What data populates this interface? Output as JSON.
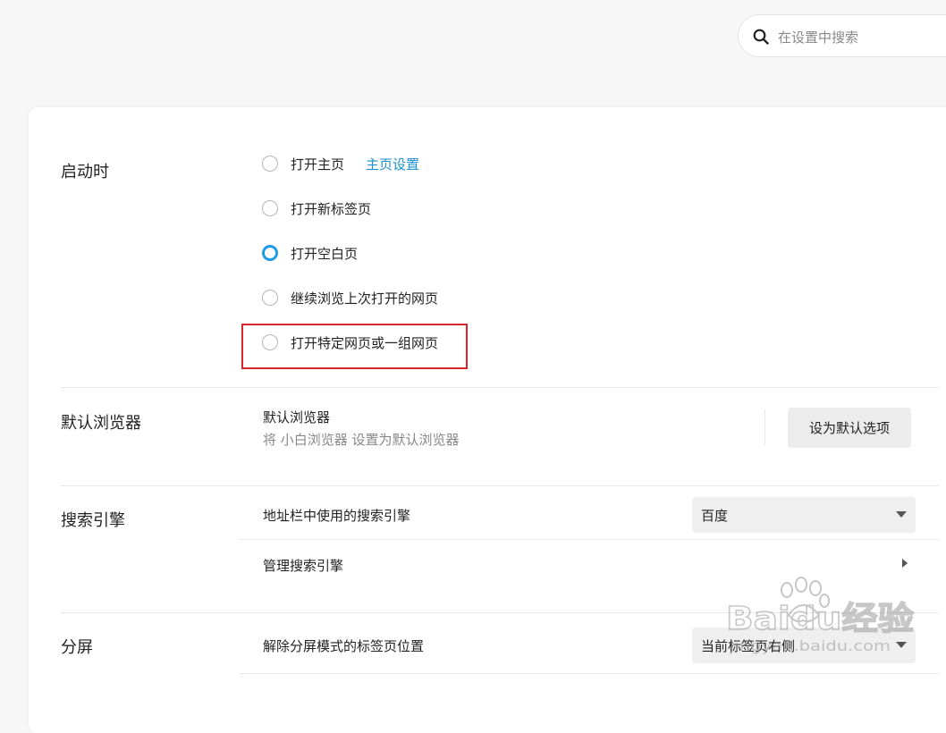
{
  "search": {
    "placeholder": "在设置中搜索"
  },
  "startup": {
    "title": "启动时",
    "options": [
      {
        "label": "打开主页",
        "checked": false
      },
      {
        "label": "打开新标签页",
        "checked": false
      },
      {
        "label": "打开空白页",
        "checked": true
      },
      {
        "label": "继续浏览上次打开的网页",
        "checked": false
      },
      {
        "label": "打开特定网页或一组网页",
        "checked": false
      }
    ],
    "homepage_link": "主页设置"
  },
  "default_browser": {
    "title": "默认浏览器",
    "heading": "默认浏览器",
    "description": "将 小白浏览器 设置为默认浏览器",
    "button": "设为默认选项"
  },
  "search_engine": {
    "title": "搜索引擎",
    "address_bar_label": "地址栏中使用的搜索引擎",
    "selected": "百度",
    "manage_label": "管理搜索引擎"
  },
  "split_screen": {
    "title": "分屏",
    "label": "解除分屏模式的标签页位置",
    "selected": "当前标签页右侧"
  },
  "watermark": {
    "brand": "Baidu经验",
    "url": "jingyan.baidu.com"
  },
  "colors": {
    "accent": "#1e9be9",
    "link": "#1b8fce",
    "highlight": "#d9262d"
  }
}
